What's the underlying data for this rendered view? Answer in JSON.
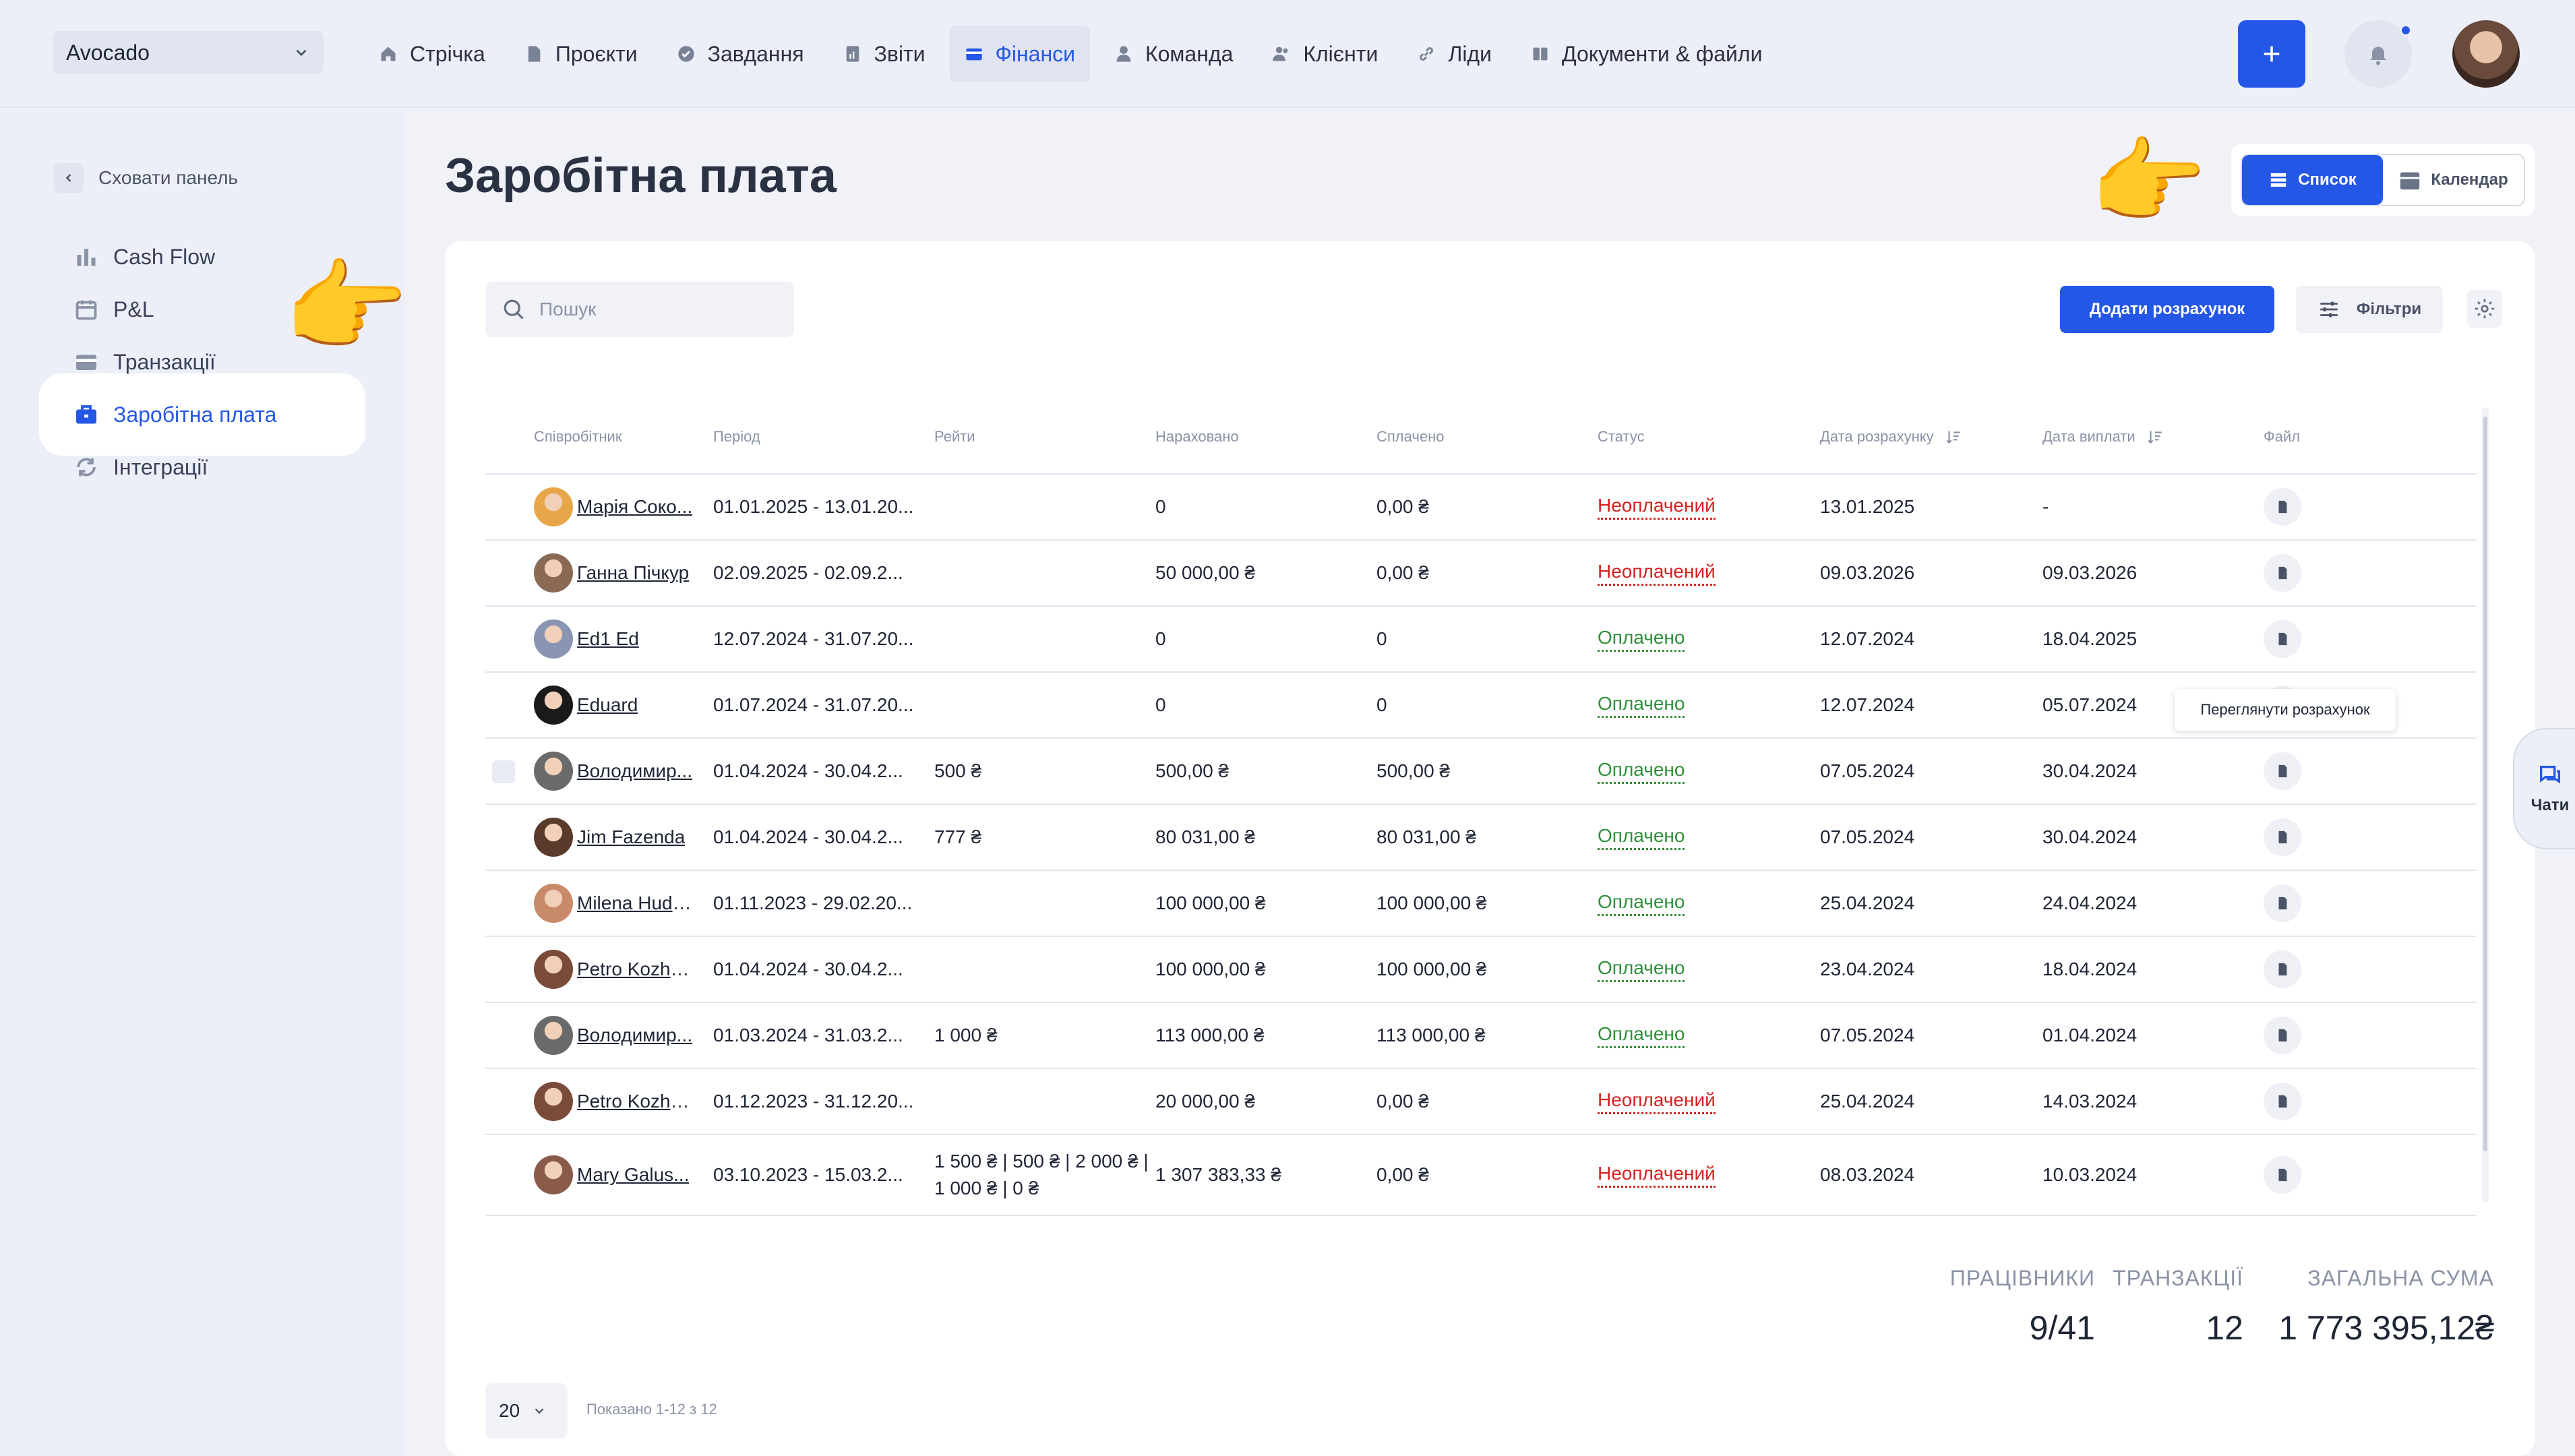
{
  "topbar": {
    "company": "Avocado",
    "nav": [
      {
        "label": "Стрічка",
        "icon": "home-icon"
      },
      {
        "label": "Проєкти",
        "icon": "document-icon"
      },
      {
        "label": "Завдання",
        "icon": "check-circle-icon"
      },
      {
        "label": "Звіти",
        "icon": "report-icon"
      },
      {
        "label": "Фінанси",
        "icon": "wallet-icon",
        "active": true
      },
      {
        "label": "Команда",
        "icon": "person-icon"
      },
      {
        "label": "Клієнти",
        "icon": "people-icon"
      },
      {
        "label": "Ліди",
        "icon": "link-icon"
      },
      {
        "label": "Документи & файли",
        "icon": "folder-icon"
      }
    ]
  },
  "sidebar": {
    "hide_label": "Сховати панель",
    "items": [
      {
        "label": "Cash Flow",
        "icon": "bar-chart-icon"
      },
      {
        "label": "P&L",
        "icon": "calendar-icon"
      },
      {
        "label": "Транзакції",
        "icon": "card-icon"
      },
      {
        "label": "Заробітна плата",
        "icon": "briefcase-icon",
        "active": true
      },
      {
        "label": "Інтеграції",
        "icon": "sync-icon"
      }
    ]
  },
  "main": {
    "title": "Заробітна плата",
    "view_switch": {
      "list": "Список",
      "calendar": "Календар"
    },
    "search_placeholder": "Пошук",
    "add_button": "Додати розрахунок",
    "filter_button": "Фільтри",
    "columns": [
      "Співробітник",
      "Період",
      "Рейти",
      "Нараховано",
      "Сплачено",
      "Статус",
      "Дата розрахунку",
      "Дата виплати",
      "Файл"
    ],
    "rows": [
      {
        "name": "Марія Соко...",
        "period": "01.01.2025 - 13.01.20...",
        "rates": "",
        "accrued": "0",
        "paid": "0,00 ₴",
        "status": "Неоплачений",
        "calc_date": "13.01.2025",
        "pay_date": "-",
        "avatar_color": "#e8a64a"
      },
      {
        "name": "Ганна Пічкур",
        "period": "02.09.2025 - 02.09.2...",
        "rates": "",
        "accrued": "50 000,00 ₴",
        "paid": "0,00 ₴",
        "status": "Неоплачений",
        "calc_date": "09.03.2026",
        "pay_date": "09.03.2026",
        "avatar_color": "#8a6a55"
      },
      {
        "name": "Ed1 Ed",
        "period": "12.07.2024 - 31.07.20...",
        "rates": "",
        "accrued": "0",
        "paid": "0",
        "status": "Оплачено",
        "calc_date": "12.07.2024",
        "pay_date": "18.04.2025",
        "avatar_color": "#8a95b4"
      },
      {
        "name": "Eduard",
        "period": "01.07.2024 - 31.07.20...",
        "rates": "",
        "accrued": "0",
        "paid": "0",
        "status": "Оплачено",
        "calc_date": "12.07.2024",
        "pay_date": "05.07.2024",
        "avatar_color": "#1a1a1a"
      },
      {
        "name": "Володимир...",
        "period": "01.04.2024 - 30.04.2...",
        "rates": "500 ₴",
        "accrued": "500,00 ₴",
        "paid": "500,00 ₴",
        "status": "Оплачено",
        "calc_date": "07.05.2024",
        "pay_date": "30.04.2024",
        "avatar_color": "#6a6a6a"
      },
      {
        "name": "Jim Fazenda",
        "period": "01.04.2024 - 30.04.2...",
        "rates": "777 ₴",
        "accrued": "80 031,00 ₴",
        "paid": "80 031,00 ₴",
        "status": "Оплачено",
        "calc_date": "07.05.2024",
        "pay_date": "30.04.2024",
        "avatar_color": "#5a3a2a"
      },
      {
        "name": "Milena Huds...",
        "period": "01.11.2023 - 29.02.20...",
        "rates": "",
        "accrued": "100 000,00 ₴",
        "paid": "100 000,00 ₴",
        "status": "Оплачено",
        "calc_date": "25.04.2024",
        "pay_date": "24.04.2024",
        "avatar_color": "#c98a6a"
      },
      {
        "name": "Petro Kozhe...",
        "period": "01.04.2024 - 30.04.2...",
        "rates": "",
        "accrued": "100 000,00 ₴",
        "paid": "100 000,00 ₴",
        "status": "Оплачено",
        "calc_date": "23.04.2024",
        "pay_date": "18.04.2024",
        "avatar_color": "#7a4a3a"
      },
      {
        "name": "Володимир...",
        "period": "01.03.2024 - 31.03.2...",
        "rates": "1 000 ₴",
        "accrued": "113 000,00 ₴",
        "paid": "113 000,00 ₴",
        "status": "Оплачено",
        "calc_date": "07.05.2024",
        "pay_date": "01.04.2024",
        "avatar_color": "#6a6a6a"
      },
      {
        "name": "Petro Kozhe...",
        "period": "01.12.2023 - 31.12.20...",
        "rates": "",
        "accrued": "20 000,00 ₴",
        "paid": "0,00 ₴",
        "status": "Неоплачений",
        "calc_date": "25.04.2024",
        "pay_date": "14.03.2024",
        "avatar_color": "#7a4a3a"
      },
      {
        "name": "Mary Galus...",
        "period": "03.10.2023 - 15.03.2...",
        "rates": "1 500 ₴ | 500 ₴ | 2 000 ₴ | 1 000 ₴ | 0 ₴",
        "accrued": "1 307 383,33 ₴",
        "paid": "0,00 ₴",
        "status": "Неоплачений",
        "calc_date": "08.03.2024",
        "pay_date": "10.03.2024",
        "avatar_color": "#8a5a4a"
      }
    ],
    "tooltip": "Переглянути розрахунок",
    "summary": [
      {
        "label": "ПРАЦІВНИКИ",
        "value": "9/41"
      },
      {
        "label": "ТРАНЗАКЦІЇ",
        "value": "12"
      },
      {
        "label": "ЗАГАЛЬНА СУМА",
        "value": "1 773 395,12₴"
      }
    ],
    "page_size": "20",
    "page_info": "Показано 1-12 з 12"
  },
  "chat_label": "Чати",
  "colors": {
    "accent": "#2557e6",
    "unpaid": "#d91e1e",
    "paid": "#2f8f3a"
  }
}
